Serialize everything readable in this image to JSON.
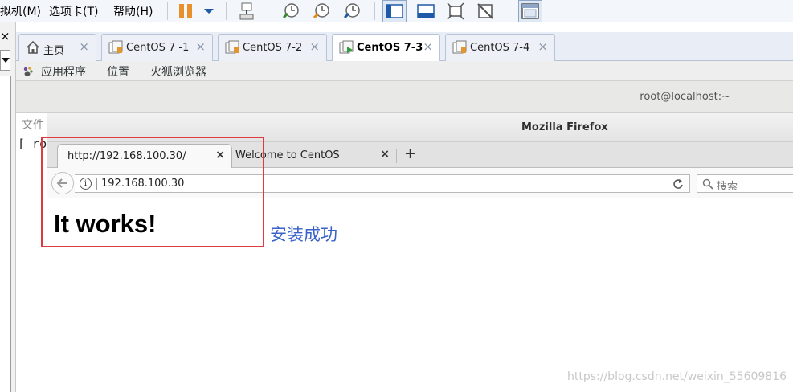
{
  "vmware": {
    "menus": [
      {
        "label": "虚拟机(M)"
      },
      {
        "label": "选项卡(T)"
      },
      {
        "label": "帮助(H)"
      }
    ],
    "tabs": [
      {
        "label": "主页",
        "icon": "home-icon",
        "active": false
      },
      {
        "label": "CentOS 7 -1",
        "icon": "vm-icon",
        "active": false
      },
      {
        "label": "CentOS 7-2",
        "icon": "vm-icon",
        "active": false
      },
      {
        "label": "CentOS 7-3",
        "icon": "vm-running-icon",
        "active": true
      },
      {
        "label": "CentOS 7-4",
        "icon": "vm-icon",
        "active": false
      }
    ],
    "tab_close_glyph": "×",
    "library_close_glyph": "×"
  },
  "gnome_panel": {
    "applications": "应用程序",
    "places": "位置",
    "browser": "火狐浏览器"
  },
  "terminal": {
    "title": "root@localhost:~",
    "menu_partial": "文件",
    "prompt_partial": "[ roo"
  },
  "firefox": {
    "window_title": "Mozilla Firefox",
    "tabs": [
      {
        "label": "http://192.168.100.30/",
        "active": true
      },
      {
        "label": "Welcome to CentOS",
        "active": false
      }
    ],
    "new_tab_glyph": "+",
    "tab_close_glyph": "×",
    "url": "192.168.100.30",
    "info_glyph": "i",
    "back_glyph": "🡐",
    "reload_glyph": "↻",
    "search_placeholder": "搜索",
    "page_heading": "It works!"
  },
  "annotation": {
    "text": "安装成功",
    "box_color": "#e0393e",
    "text_color": "#3a62c9"
  },
  "watermark": "https://blog.csdn.net/weixin_55609816",
  "colors": {
    "vm_toolbar_bg": "#f3f6fb",
    "gnome_panel_bg": "#edeeed",
    "firefox_titlebar": "#e4e4e4"
  }
}
